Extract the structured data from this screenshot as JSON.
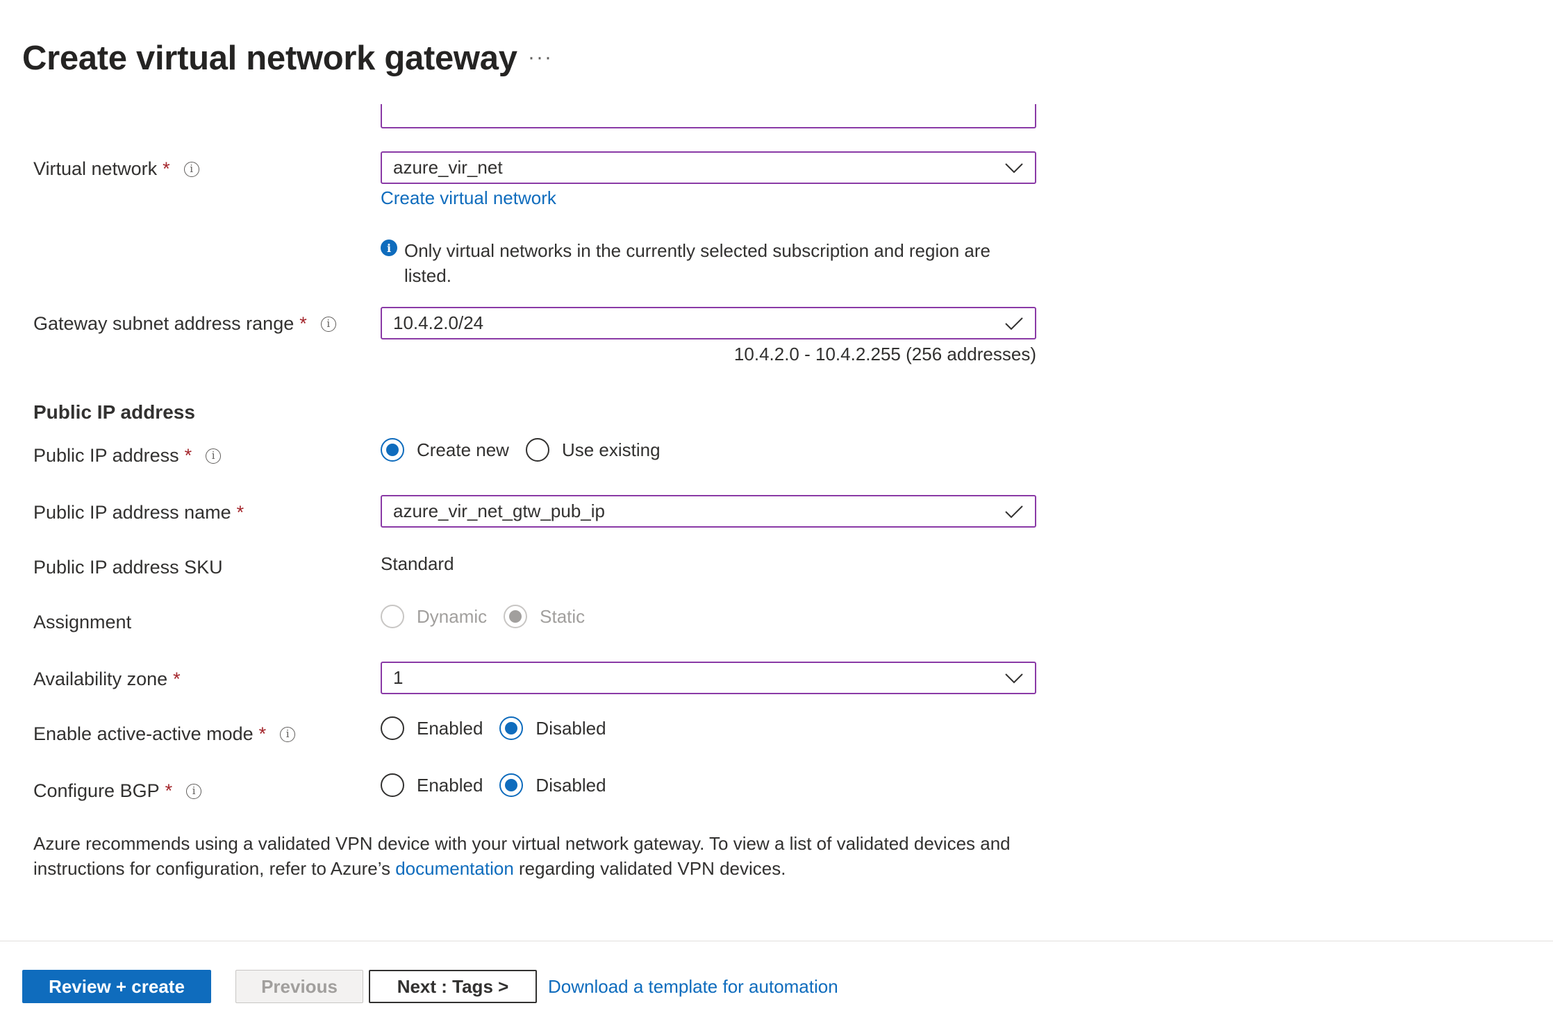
{
  "header": {
    "title": "Create virtual network gateway",
    "more_label": "···"
  },
  "form": {
    "virtual_network": {
      "label": "Virtual network",
      "required_mark": "*",
      "value": "azure_vir_net",
      "create_link": "Create virtual network",
      "info_note": "Only virtual networks in the currently selected subscription and region are listed."
    },
    "gateway_subnet": {
      "label": "Gateway subnet address range",
      "required_mark": "*",
      "value": "10.4.2.0/24",
      "range_hint": "10.4.2.0 - 10.4.2.255 (256 addresses)"
    },
    "public_ip_section_title": "Public IP address",
    "public_ip": {
      "label": "Public IP address",
      "required_mark": "*",
      "options": [
        "Create new",
        "Use existing"
      ],
      "selected": "Create new"
    },
    "public_ip_name": {
      "label": "Public IP address name",
      "required_mark": "*",
      "value": "azure_vir_net_gtw_pub_ip"
    },
    "public_ip_sku": {
      "label": "Public IP address SKU",
      "value": "Standard"
    },
    "assignment": {
      "label": "Assignment",
      "options": [
        "Dynamic",
        "Static"
      ],
      "selected": "Static",
      "disabled": true
    },
    "availability_zone": {
      "label": "Availability zone",
      "required_mark": "*",
      "value": "1"
    },
    "active_active": {
      "label": "Enable active-active mode",
      "required_mark": "*",
      "options": [
        "Enabled",
        "Disabled"
      ],
      "selected": "Disabled"
    },
    "bgp": {
      "label": "Configure BGP",
      "required_mark": "*",
      "options": [
        "Enabled",
        "Disabled"
      ],
      "selected": "Disabled"
    },
    "recommendation": {
      "text_before": "Azure recommends using a validated VPN device with your virtual network gateway. To view a list of validated devices and instructions for configuration, refer to Azure’s ",
      "link": "documentation",
      "text_after": " regarding validated VPN devices."
    }
  },
  "footer": {
    "review_create": "Review + create",
    "previous": "Previous",
    "next": "Next : Tags >",
    "download_template": "Download a template for automation"
  },
  "colors": {
    "accent": "#0f6cbd",
    "field_border": "#8a3aa6",
    "required": "#a4262c"
  }
}
